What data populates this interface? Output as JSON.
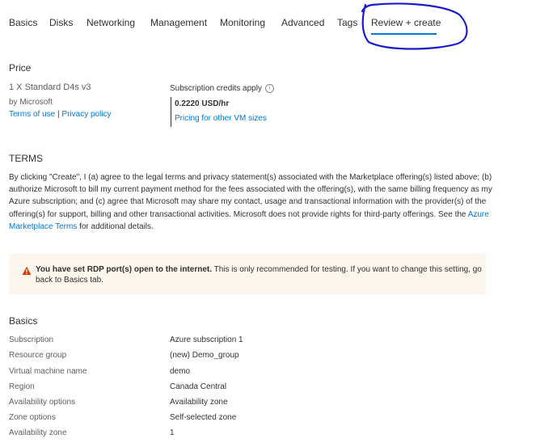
{
  "tabs": [
    {
      "label": "Basics"
    },
    {
      "label": "Disks"
    },
    {
      "label": "Networking"
    },
    {
      "label": "Management"
    },
    {
      "label": "Monitoring"
    },
    {
      "label": "Advanced"
    },
    {
      "label": "Tags"
    },
    {
      "label": "Review + create",
      "active": true
    }
  ],
  "price": {
    "heading": "Price",
    "product": "1 X Standard D4s v3",
    "publisher": "by Microsoft",
    "terms_link": "Terms of use",
    "separator": "|",
    "privacy_link": "Privacy policy",
    "credits_label": "Subscription credits apply",
    "info_icon": "info-icon",
    "amount": "0.2220 USD/hr",
    "pricing_link": "Pricing for other VM sizes"
  },
  "terms": {
    "heading": "TERMS",
    "body_before_link": "By clicking \"Create\", I (a) agree to the legal terms and privacy statement(s) associated with the Marketplace offering(s) listed above; (b) authorize Microsoft to bill my current payment method for the fees associated with the offering(s), with the same billing frequency as my Azure subscription; and (c) agree that Microsoft may share my contact, usage and transactional information with the provider(s) of the offering(s) for support, billing and other transactional activities. Microsoft does not provide rights for third-party offerings. See the ",
    "link": "Azure Marketplace Terms",
    "body_after_link": " for additional details."
  },
  "warning": {
    "icon": "warning-icon",
    "bold": "You have set RDP port(s) open to the internet.",
    "text": " This is only recommended for testing.  If you want to change this setting, go back to Basics tab.",
    "color": "#d83b01"
  },
  "basics": {
    "heading": "Basics",
    "rows": [
      {
        "label": "Subscription",
        "value": "Azure subscription 1"
      },
      {
        "label": "Resource group",
        "value": "(new) Demo_group"
      },
      {
        "label": "Virtual machine name",
        "value": "demo"
      },
      {
        "label": "Region",
        "value": "Canada Central"
      },
      {
        "label": "Availability options",
        "value": "Availability zone"
      },
      {
        "label": "Zone options",
        "value": "Self-selected zone"
      },
      {
        "label": "Availability zone",
        "value": "1"
      }
    ]
  },
  "colors": {
    "accent": "#0078d4",
    "annotation": "#1a1acc"
  }
}
